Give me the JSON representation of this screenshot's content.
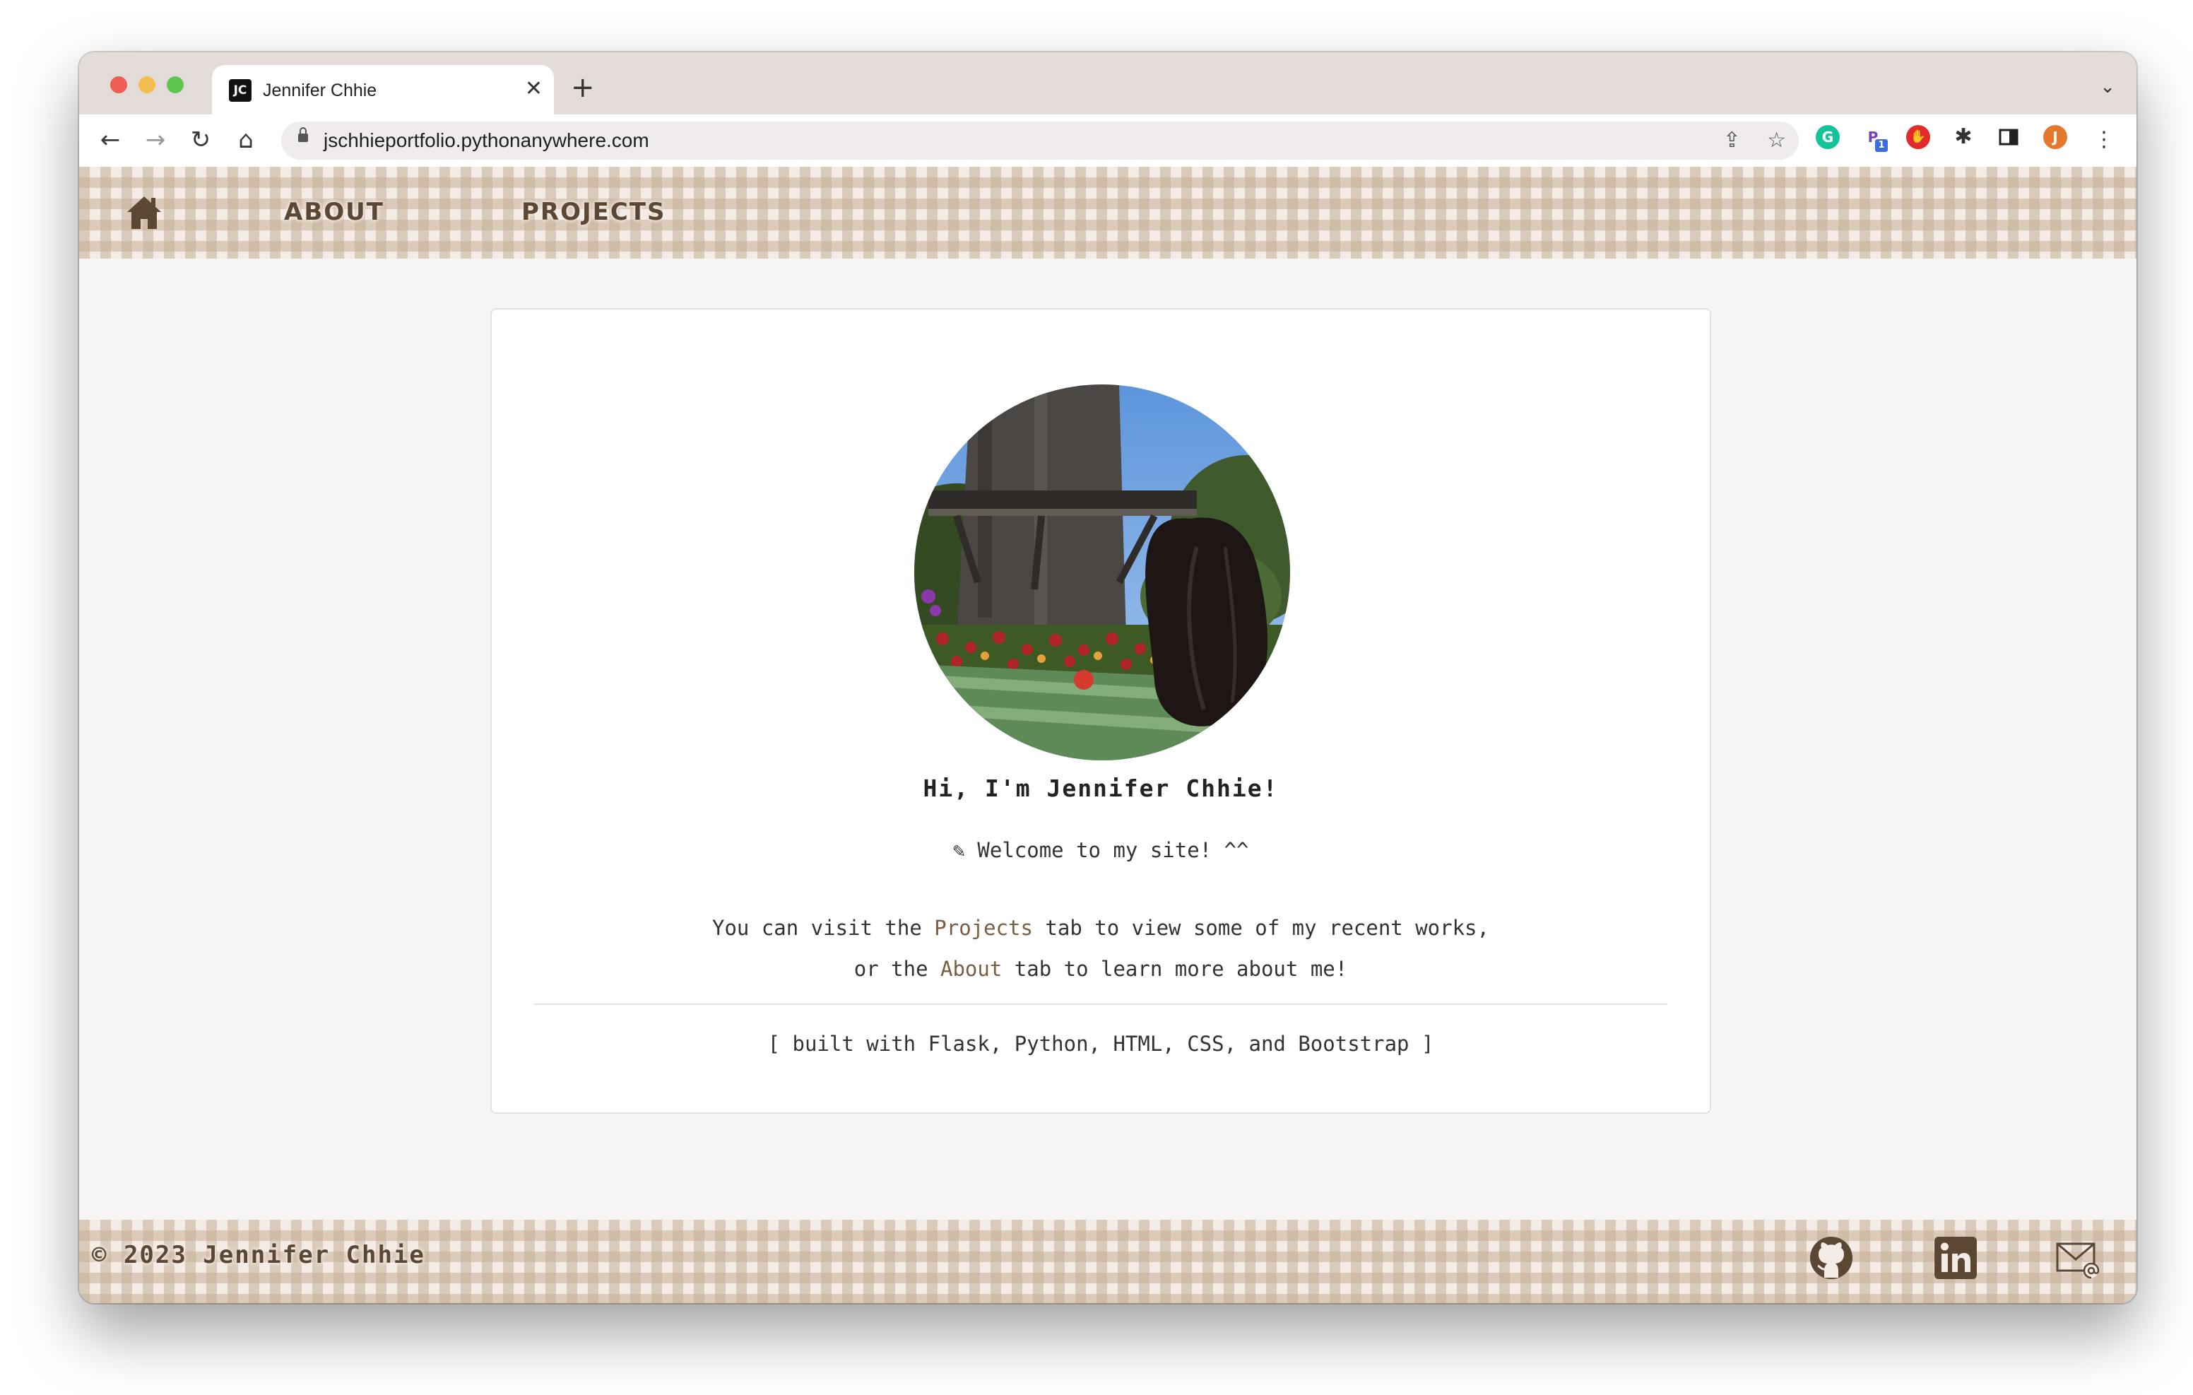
{
  "browser": {
    "tab": {
      "favicon_text": "JC",
      "title": "Jennifer Chhie",
      "close": "✕"
    },
    "new_tab": "+",
    "tab_list": "⌄",
    "toolbar": {
      "back": "←",
      "forward": "→",
      "reload": "↻",
      "home": "⌂",
      "menu": "⋮"
    },
    "url": "jschhieportfolio.pythonanywhere.com",
    "omnibox_icons": {
      "share": "⇪",
      "bookmark": "☆"
    },
    "extensions": {
      "grammarly": "G",
      "p_ext": "P",
      "p_ext_badge": "1",
      "adblock": "✋",
      "puzzle": "✱",
      "profile": "J"
    },
    "colors": {
      "grammarly": "#15c39a",
      "adblock": "#e32b2b",
      "profile": "#e8772e",
      "p_ext": "#7b3fbf"
    }
  },
  "site": {
    "nav": {
      "about": "ABOUT",
      "projects": "PROJECTS"
    },
    "card": {
      "greeting": "Hi, I'm Jennifer Chhie!",
      "welcome_icon": "✎",
      "welcome": "Welcome to my site! ^^",
      "line1_pre": "You can visit the ",
      "line1_link": "Projects",
      "line1_post": " tab to view some of my recent works,",
      "line2_pre": "or the ",
      "line2_link": "About",
      "line2_post": " tab to learn more about me!",
      "built_with": "[ built with Flask, Python, HTML, CSS, and Bootstrap ]"
    },
    "footer": {
      "copyright": "© 2023 Jennifer Chhie"
    },
    "colors": {
      "accent": "#5c4634",
      "link": "#7a5e42",
      "gingham": "#c6b096",
      "page_bg": "#f6f5f3"
    }
  }
}
